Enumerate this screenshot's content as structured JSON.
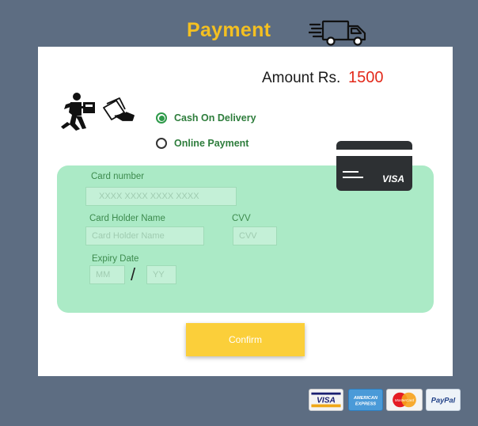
{
  "header": {
    "title": "Payment",
    "truck_icon": "delivery-truck-icon"
  },
  "amount": {
    "label": "Amount Rs.",
    "value": "1500",
    "value_color": "#e32a1b"
  },
  "payment_options": [
    {
      "label": "Cash On Delivery",
      "selected": true
    },
    {
      "label": "Online Payment",
      "selected": false
    }
  ],
  "form": {
    "card_number": {
      "label": "Card number",
      "placeholder": "XXXX  XXXX XXXX XXXX"
    },
    "card_holder": {
      "label": "Card Holder Name",
      "placeholder": "Card Holder Name"
    },
    "cvv": {
      "label": "CVV",
      "placeholder": "CVV"
    },
    "expiry": {
      "label": "Expiry Date",
      "month_placeholder": "MM",
      "separator": "/",
      "year_placeholder": "YY"
    }
  },
  "bank_card": {
    "brand": "VISA"
  },
  "confirm_button": {
    "label": "Confirm"
  },
  "payment_logos": {
    "visa": "VISA",
    "amex_line1": "AMERICAN",
    "amex_line2": "EXPRESS",
    "mastercard": "MasterCard",
    "paypal": "PayPal"
  },
  "colors": {
    "background": "#5d6d82",
    "accent": "#f4c021",
    "form_bg": "#abeac6",
    "option_text": "#2e7d3c",
    "confirm_bg": "#fbcf3a"
  }
}
